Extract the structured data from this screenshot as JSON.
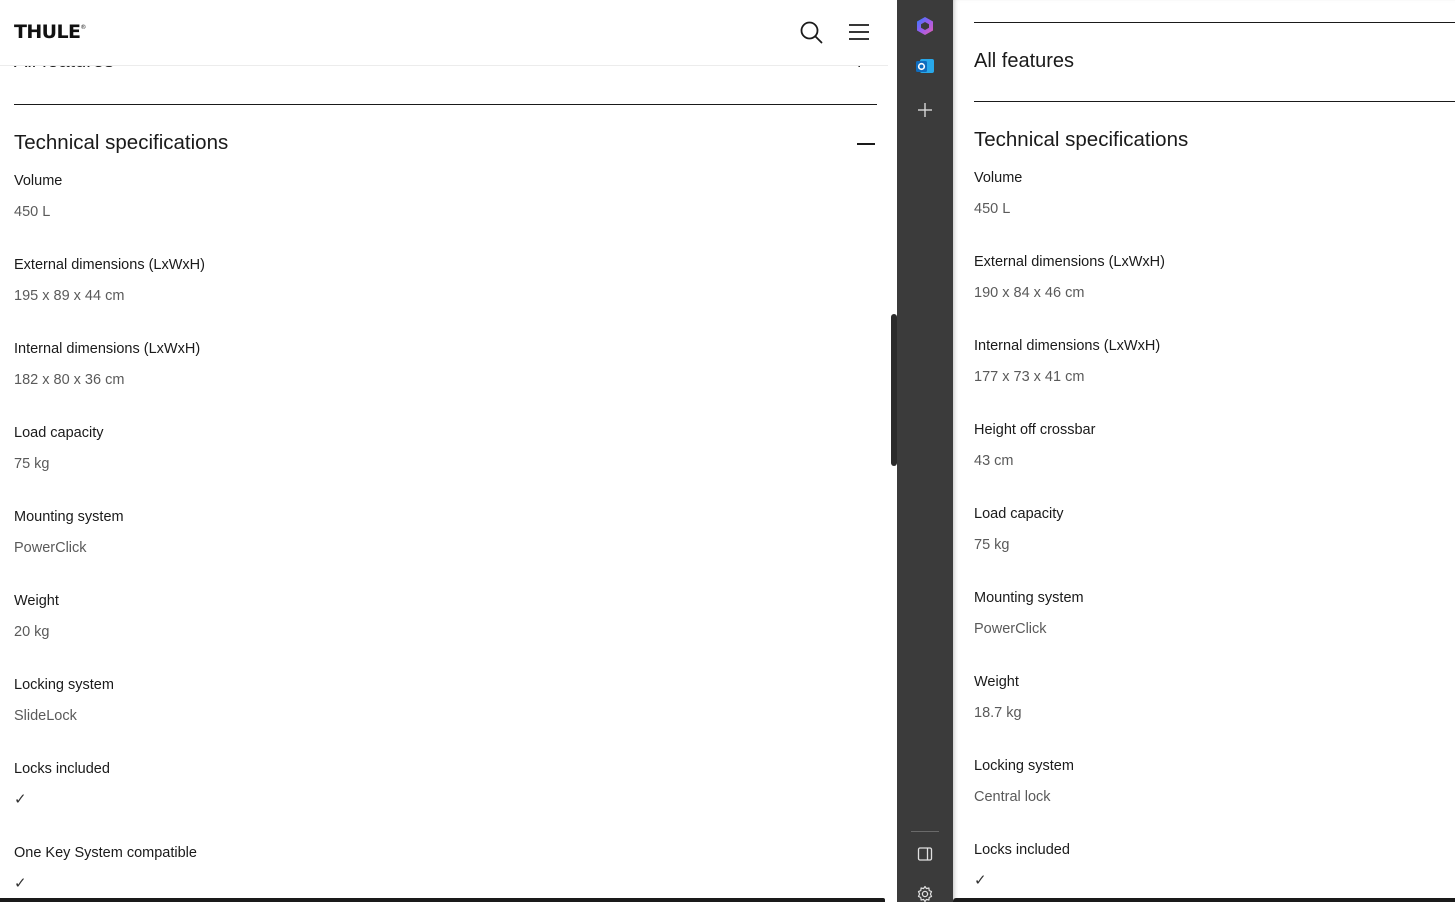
{
  "left": {
    "header": {
      "logo_text": "THULE",
      "logo_mark": "®",
      "search_icon": "search-icon",
      "menu_icon": "hamburger-menu-icon"
    },
    "peek_section": {
      "title": "All features",
      "icon": "+"
    },
    "tech_specs": {
      "title": "Technical specifications",
      "items": [
        {
          "label": "Volume",
          "value": "450 L"
        },
        {
          "label": "External dimensions (LxWxH)",
          "value": "195 x 89 x 44 cm"
        },
        {
          "label": "Internal dimensions (LxWxH)",
          "value": "182 x 80 x 36 cm"
        },
        {
          "label": "Load capacity",
          "value": "75 kg"
        },
        {
          "label": "Mounting system",
          "value": "PowerClick"
        },
        {
          "label": "Weight",
          "value": "20 kg"
        },
        {
          "label": "Locking system",
          "value": "SlideLock"
        },
        {
          "label": "Locks included",
          "value": "✓"
        },
        {
          "label": "One Key System compatible",
          "value": "✓"
        }
      ]
    }
  },
  "sidebar": {
    "items": [
      "copilot-icon",
      "outlook-icon",
      "add-icon",
      "sidebar-toggle-icon",
      "settings-gear-icon"
    ]
  },
  "right": {
    "features_title": "All features",
    "tech_specs": {
      "title": "Technical specifications",
      "items": [
        {
          "label": "Volume",
          "value": "450 L"
        },
        {
          "label": "External dimensions (LxWxH)",
          "value": "190 x 84 x 46 cm"
        },
        {
          "label": "Internal dimensions (LxWxH)",
          "value": "177 x 73 x 41 cm"
        },
        {
          "label": "Height off crossbar",
          "value": "43 cm"
        },
        {
          "label": "Load capacity",
          "value": "75 kg"
        },
        {
          "label": "Mounting system",
          "value": "PowerClick"
        },
        {
          "label": "Weight",
          "value": "18.7 kg"
        },
        {
          "label": "Locking system",
          "value": "Central lock"
        },
        {
          "label": "Locks included",
          "value": "✓"
        }
      ]
    }
  },
  "colors": {
    "sidebar_bg": "#3b3b3b",
    "text": "#1a1a1a",
    "muted_text": "#5a5a5a",
    "outlook_blue": "#0f6cbd"
  }
}
